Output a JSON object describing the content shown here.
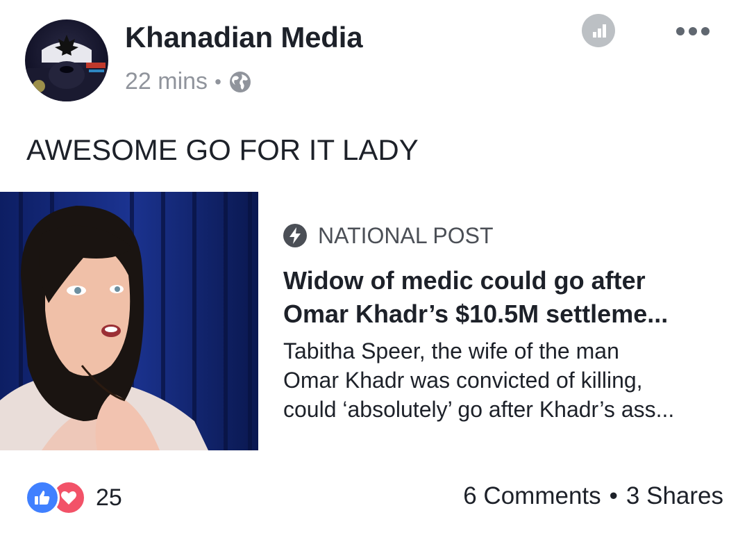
{
  "post": {
    "author": "Khanadian Media",
    "timestamp": "22 mins",
    "separator": "•",
    "audience_icon": "globe-icon",
    "text": "AWESOME GO FOR IT LADY"
  },
  "header_actions": {
    "insights_icon": "bar-chart-icon",
    "more_icon": "more-dots-icon"
  },
  "link": {
    "source_icon": "lightning-bolt-icon",
    "source": "NATIONAL POST",
    "headline_lines": [
      "Widow of medic could go after",
      "Omar Khadr’s $10.5M settleme..."
    ],
    "description_lines": [
      "Tabitha Speer, the wife of the man",
      "Omar Khadr was convicted of killing,",
      "could ‘absolutely’ go after Khadr’s ass..."
    ]
  },
  "footer": {
    "reaction_icons": [
      "like-icon",
      "love-icon"
    ],
    "reaction_count": "25",
    "comments": "6 Comments",
    "separator": "•",
    "shares": "3 Shares"
  },
  "colors": {
    "like": "#4080ff",
    "love": "#f25268",
    "meta_gray": "#90949c",
    "text": "#1d2129"
  }
}
